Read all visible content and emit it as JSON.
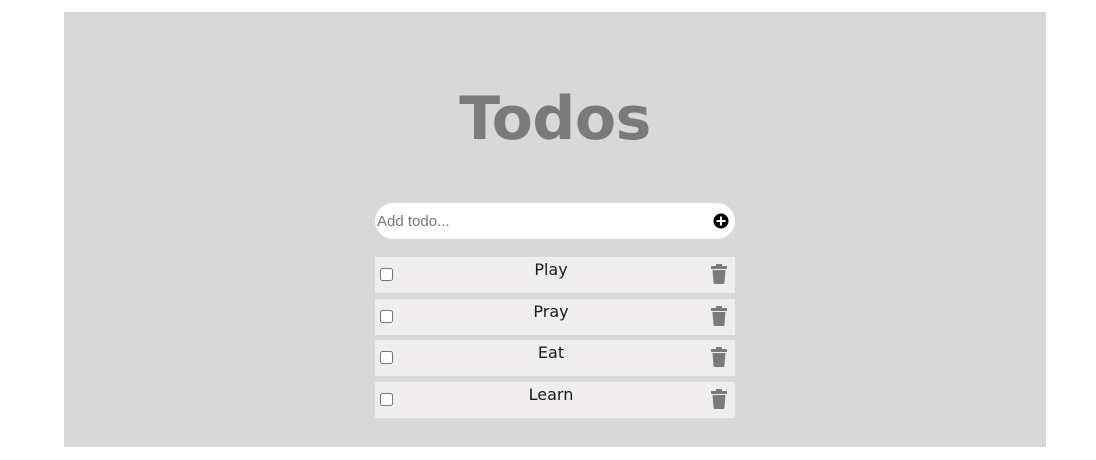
{
  "header": {
    "title": "Todos"
  },
  "add_form": {
    "placeholder": "Add todo...",
    "value": "",
    "add_icon": "plus-circle-icon"
  },
  "todos": [
    {
      "label": "Play",
      "checked": false,
      "delete_icon": "trash-icon"
    },
    {
      "label": "Pray",
      "checked": false,
      "delete_icon": "trash-icon"
    },
    {
      "label": "Eat",
      "checked": false,
      "delete_icon": "trash-icon"
    },
    {
      "label": "Learn",
      "checked": false,
      "delete_icon": "trash-icon"
    }
  ],
  "colors": {
    "panel": "#d8d8d8",
    "title": "#7a7a7a",
    "item_background": "#efedee",
    "icon": "#7a7a7a"
  }
}
